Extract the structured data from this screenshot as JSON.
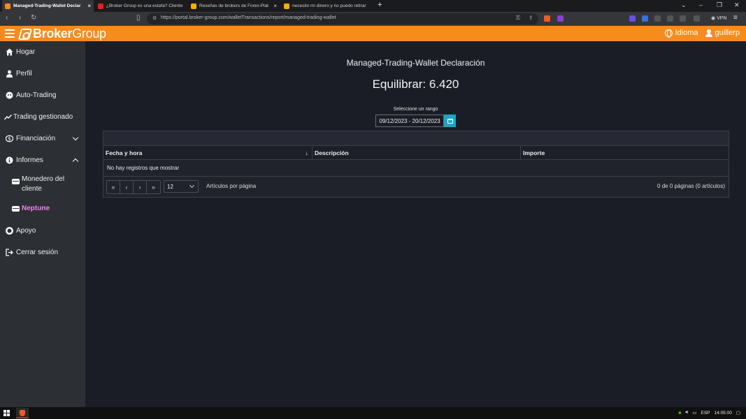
{
  "browser": {
    "tabs": [
      {
        "title": "Managed-Trading-Wallet Declar",
        "active": true,
        "favicon_color": "#f78c1e"
      },
      {
        "title": "¿Broker Group es una estafa? Cliente ¡",
        "active": false,
        "favicon_color": "#e62117"
      },
      {
        "title": "Reseñas de brokers de Forex-Plat",
        "active": false,
        "favicon_color": "#f2b200"
      },
      {
        "title": "necesito mi dinero y no puedo retirar",
        "active": false,
        "favicon_color": "#f2b200"
      }
    ],
    "new_tab": "+",
    "url": "https://portal.broker-group.com/walletTransactions/report/managed-trading-wallet",
    "vpn_label": "VPN"
  },
  "header": {
    "brand_bold": "Broker",
    "brand_light": "Group",
    "language_label": "Idioma",
    "user_label": "guillerp",
    "accent": "#f78c1e"
  },
  "sidebar": {
    "items": [
      {
        "label": "Hogar",
        "icon": "home-icon"
      },
      {
        "label": "Perfil",
        "icon": "user-icon"
      },
      {
        "label": "Auto-Trading",
        "icon": "robot-icon"
      },
      {
        "label": "Trading gestionado",
        "icon": "chart-line-icon"
      },
      {
        "label": "Financiación",
        "icon": "dollar-icon"
      },
      {
        "label": "Informes",
        "icon": "info-icon"
      },
      {
        "label": "Apoyo",
        "icon": "lifebuoy-icon"
      },
      {
        "label": "Cerrar sesión",
        "icon": "logout-icon"
      }
    ],
    "sub_items": [
      {
        "label": "Monedero del cliente",
        "icon": "wallet-icon",
        "active": false
      },
      {
        "label": "Neptune",
        "icon": "wallet-icon",
        "active": true
      }
    ],
    "active_color": "#ee82ee"
  },
  "main": {
    "title": "Managed-Trading-Wallet Declaración",
    "balance": "Equilibrar: 6.420",
    "range_label": "Seleccione un rango",
    "range_value": "09/12/2023 - 20/12/2023",
    "table": {
      "columns": [
        "Fecha y hora",
        "Descripción",
        "Importe"
      ],
      "sort_indicator": "↓",
      "empty_message": "No hay registros que mostrar"
    },
    "pager": {
      "buttons": [
        "«",
        "‹",
        "›",
        "»"
      ],
      "page_size": "12",
      "page_size_label": "Artículos por página",
      "info": "0 de 0 páginas (0 artículos)"
    }
  },
  "taskbar": {
    "language": "ESP",
    "time": "14:05:00"
  }
}
